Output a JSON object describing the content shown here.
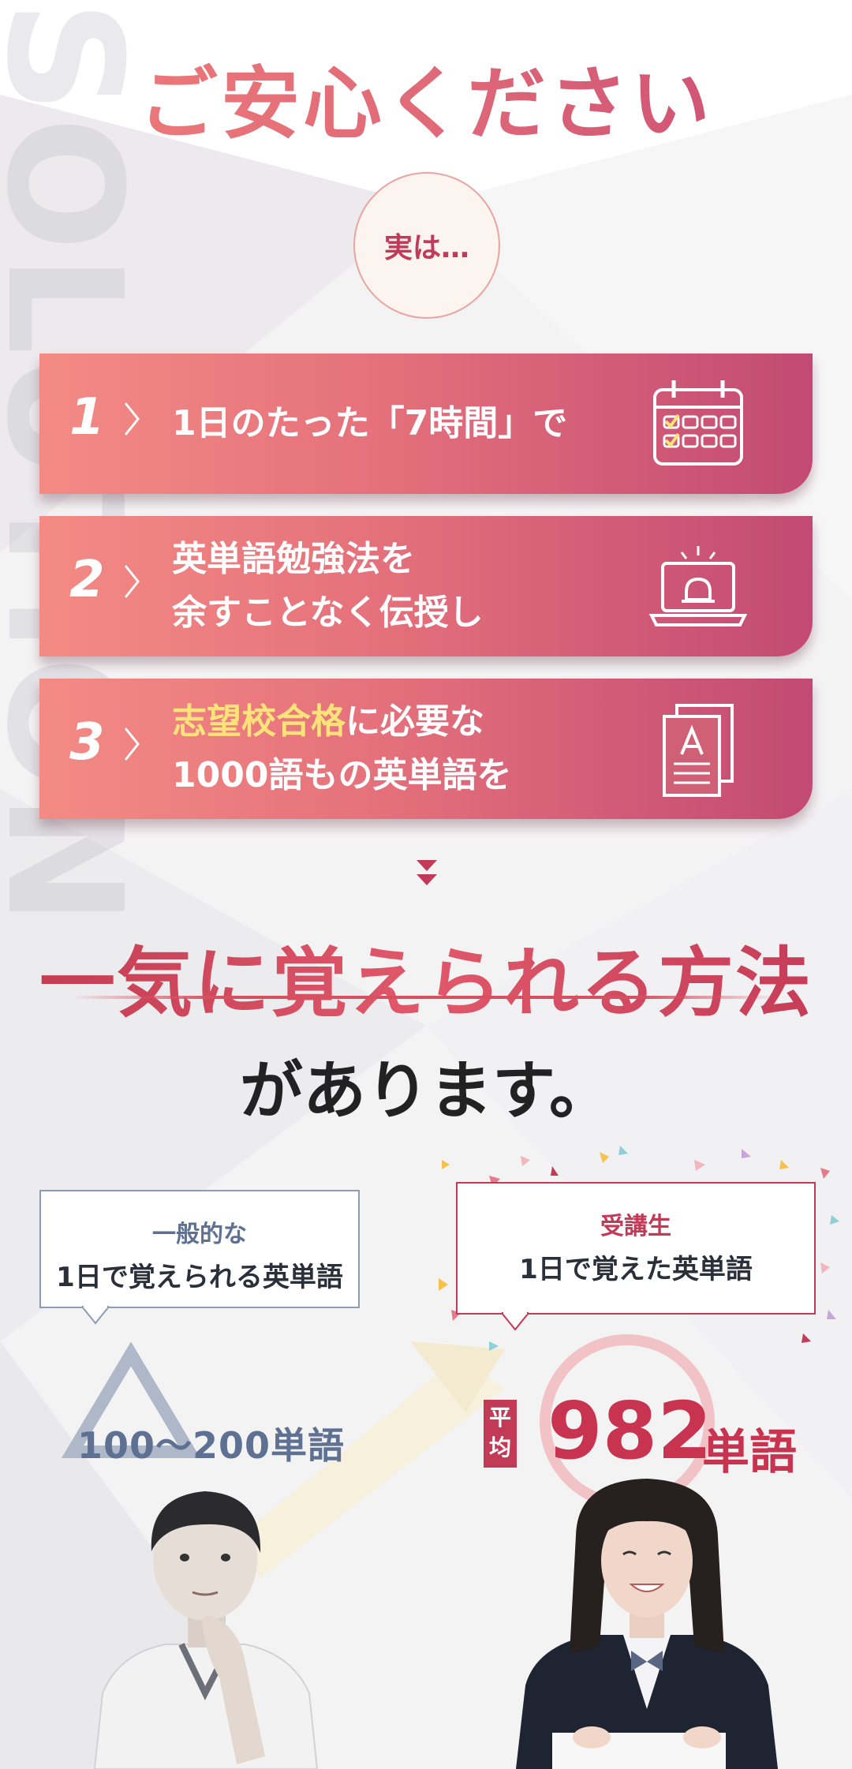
{
  "watermark": "SOLUTION",
  "headline": "ご安心ください",
  "badge": "実は…",
  "cards": [
    {
      "num": "1",
      "line1": "1日のたった「7時間」で",
      "line2": "",
      "highlight": ""
    },
    {
      "num": "2",
      "line1": "英単語勉強法を",
      "line2": "余すことなく伝授し",
      "highlight": ""
    },
    {
      "num": "3",
      "line1": "に必要な",
      "line2": "1000語もの英単語を",
      "highlight": "志望校合格"
    }
  ],
  "icons": [
    "calendar-icon",
    "laptop-bell-icon",
    "document-icon"
  ],
  "big_title": "一気に覚えられる方法",
  "subtitle": "があります。",
  "compare": {
    "left": {
      "label1": "一般的な",
      "label2": "1日で覚えられる英単語",
      "value": "100～200単語"
    },
    "right": {
      "label1": "受講生",
      "label2": "1日で覚えた英単語",
      "prefix": "平均",
      "value": "982",
      "unit": "単語"
    }
  },
  "colors": {
    "accent": "#c23a55",
    "gradient_start": "#f38b84",
    "gradient_end": "#c24a74",
    "muted": "#5f7192"
  }
}
